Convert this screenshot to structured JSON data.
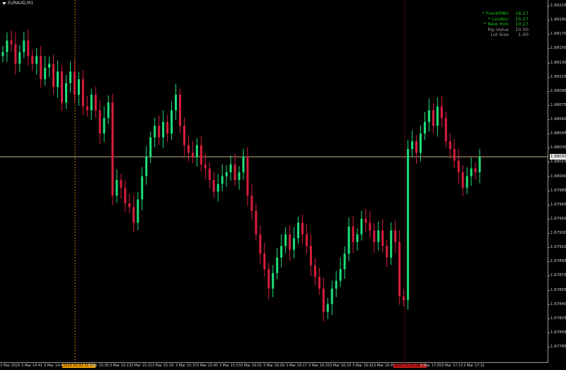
{
  "symbol": "EURAUD,M1",
  "info_panel": [
    {
      "label": "* FrankfMkt",
      "value": "16:27",
      "color": "green"
    },
    {
      "label": "* London",
      "value": "15:27",
      "color": "green"
    },
    {
      "label": "* New York",
      "value": "10:27",
      "color": "green"
    },
    {
      "label": "Pip Value",
      "value": "10.00",
      "color": "gray"
    },
    {
      "label": "Lot Size",
      "value": "1.00",
      "color": "gray"
    }
  ],
  "current_price": "1.68030",
  "colors": {
    "bull": "#1ee07a",
    "bear": "#d81e3c",
    "hline": "#e0c890",
    "vline_orange": "#c98a1a",
    "vline_red": "#8a1010"
  },
  "chart_data": {
    "type": "candlestick",
    "y_axis_labels": [
      "1.68225",
      "1.68190",
      "1.68170",
      "1.68150",
      "1.68130",
      "1.68115",
      "1.68095",
      "1.68075",
      "1.68060",
      "1.68045",
      "1.68030",
      "1.68015",
      "1.68000",
      "1.67985",
      "1.67965",
      "1.67950",
      "1.67930",
      "1.67910",
      "1.67895",
      "1.67875",
      "1.67855",
      "1.67840",
      "1.67825",
      "1.67805",
      "1.67785"
    ],
    "x_axis_labels": [
      "3 Mar 2025",
      "3 Mar 14:41",
      "3 Mar 14:49",
      "2025.03.03 15:00",
      "3 Mar 15:05",
      "3 Mar 15:13",
      "3 Mar 15:21",
      "3 Mar 15:29",
      "3 Mar 15:37",
      "3 Mar 15:45",
      "3 Mar 15:53",
      "3 Mar 16:01",
      "3 Mar 16:09",
      "3 Mar 16:17",
      "3 Mar 16:25",
      "3 Mar 16:33",
      "3 Mar 16:41",
      "3 Mar 16:49",
      "2025.03.03 16:57",
      "3 Mar 17:05",
      "3 Mar 17:13",
      "3 Mar 17:21"
    ],
    "highlighted_x_labels": {
      "orange": "2025.03.03 15:00",
      "red": "2025.03.03 16:57"
    },
    "ylim": [
      1.67785,
      1.68225
    ],
    "horizontal_line_price": 1.6803,
    "closes": [
      1.68165,
      1.6818,
      1.68175,
      1.6815,
      1.68165,
      1.6818,
      1.6816,
      1.6815,
      1.6816,
      1.6813,
      1.68145,
      1.6815,
      1.6812,
      1.6814,
      1.681,
      1.68125,
      1.6814,
      1.6811,
      1.6813,
      1.68095,
      1.6809,
      1.6811,
      1.6809,
      1.6806,
      1.6808,
      1.681,
      1.6798,
      1.68,
      1.6799,
      1.6797,
      1.67965,
      1.67945,
      1.67975,
      1.68005,
      1.6803,
      1.68055,
      1.6807,
      1.68055,
      1.68075,
      1.6806,
      1.6809,
      1.6811,
      1.6807,
      1.68045,
      1.68035,
      1.6803,
      1.68045,
      1.6802,
      1.68015,
      1.68,
      1.67985,
      1.67995,
      1.68005,
      1.6801,
      1.6802,
      1.68,
      1.6801,
      1.6803,
      1.6798,
      1.6796,
      1.6793,
      1.67905,
      1.67885,
      1.6786,
      1.6788,
      1.679,
      1.67915,
      1.6793,
      1.6791,
      1.67925,
      1.67945,
      1.6793,
      1.67915,
      1.6789,
      1.67875,
      1.6786,
      1.6783,
      1.6784,
      1.6786,
      1.6787,
      1.67885,
      1.67905,
      1.6794,
      1.6792,
      1.6793,
      1.6795,
      1.67945,
      1.67935,
      1.6792,
      1.67935,
      1.67915,
      1.679,
      1.67935,
      1.6792,
      1.6785,
      1.67845,
      1.6804,
      1.6805,
      1.68035,
      1.6806,
      1.68075,
      1.6809,
      1.6807,
      1.68095,
      1.6808,
      1.6805,
      1.6804,
      1.68025,
      1.6801,
      1.6799,
      1.68005,
      1.68015,
      1.6801,
      1.6803
    ]
  }
}
